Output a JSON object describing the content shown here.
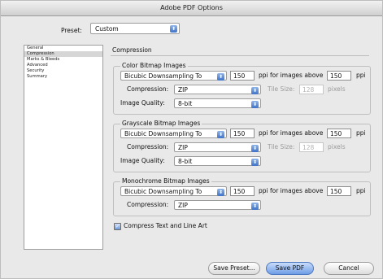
{
  "window": {
    "title": "Adobe PDF Options"
  },
  "preset": {
    "label": "Preset:",
    "value": "Custom"
  },
  "sidebar": {
    "items": [
      "General",
      "Compression",
      "Marks & Bleeds",
      "Advanced",
      "Security",
      "Summary"
    ],
    "selected_index": 1
  },
  "main": {
    "title": "Compression"
  },
  "color": {
    "title": "Color Bitmap Images",
    "downsample": "Bicubic Downsampling To",
    "ppi": "150",
    "ppi_label": "ppi for images above",
    "above": "150",
    "ppi_unit": "ppi",
    "compression_label": "Compression:",
    "compression": "ZIP",
    "tile_label": "Tile Size:",
    "tile": "128",
    "tile_unit": "pixels",
    "quality_label": "Image Quality:",
    "quality": "8-bit"
  },
  "gray": {
    "title": "Grayscale Bitmap Images",
    "downsample": "Bicubic Downsampling To",
    "ppi": "150",
    "ppi_label": "ppi for images above",
    "above": "150",
    "ppi_unit": "ppi",
    "compression_label": "Compression:",
    "compression": "ZIP",
    "tile_label": "Tile Size:",
    "tile": "128",
    "tile_unit": "pixels",
    "quality_label": "Image Quality:",
    "quality": "8-bit"
  },
  "mono": {
    "title": "Monochrome Bitmap Images",
    "downsample": "Bicubic Downsampling To",
    "ppi": "150",
    "ppi_label": "ppi for images above",
    "above": "150",
    "ppi_unit": "ppi",
    "compression_label": "Compression:",
    "compression": "ZIP"
  },
  "compress_text": {
    "label": "Compress Text and Line Art",
    "checked": true
  },
  "buttons": {
    "save_preset": "Save Preset...",
    "save_pdf": "Save PDF",
    "cancel": "Cancel"
  },
  "colors": {
    "accent": "#6e9de6",
    "window_bg": "#e9e9e9"
  }
}
